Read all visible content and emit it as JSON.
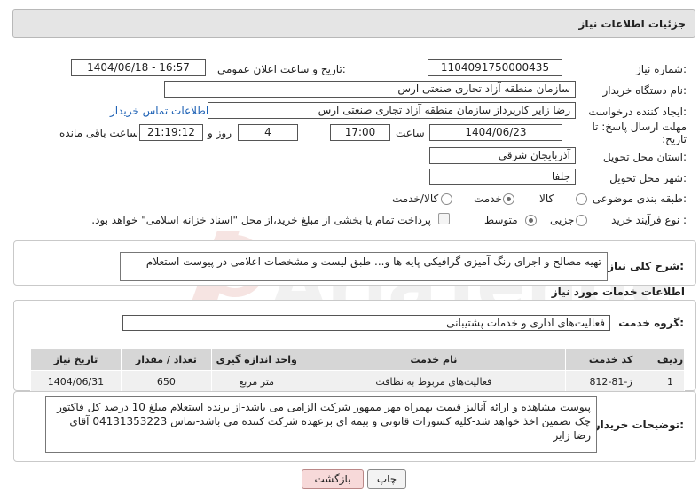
{
  "header": {
    "title": "جزئیات اطلاعات نیاز"
  },
  "fields": {
    "need_number_label": "شماره نیاز:",
    "need_number": "1104091750000435",
    "announce_label": "تاریخ و ساعت اعلان عمومی:",
    "announce_value": "1404/06/18 - 16:57",
    "buyer_org_label": "نام دستگاه خریدار:",
    "buyer_org": "سازمان منطقه آزاد تجاری صنعتی ارس",
    "creator_label": "ایجاد کننده درخواست:",
    "creator": "رضا زایر کارپرداز سازمان منطقه آزاد تجاری صنعتی ارس",
    "contact_link": "اطلاعات تماس خریدار",
    "deadline_label": "مهلت ارسال پاسخ: تا تاریخ:",
    "deadline_date": "1404/06/23",
    "time_label": "ساعت",
    "deadline_time": "17:00",
    "days_value": "4",
    "days_label": "روز و",
    "remaining_time": "21:19:12",
    "remaining_label": "ساعت باقی مانده",
    "province_label": "استان محل تحویل:",
    "province": "آذربایجان شرقی",
    "city_label": "شهر محل تحویل:",
    "city": "جلفا",
    "category_label": "طبقه بندی موضوعی:",
    "category_options": [
      "کالا",
      "خدمت",
      "کالا/خدمت"
    ],
    "purchase_type_label": "نوع فرآیند خرید :",
    "purchase_options": [
      "جزیی",
      "متوسط"
    ],
    "payment_note": "پرداخت تمام یا بخشی از مبلغ خرید،از محل \"اسناد خزانه اسلامی\" خواهد بود."
  },
  "summary": {
    "label": "شرح کلی نیاز:",
    "text": "تهیه مصالح و اجرای رنگ آمیزی گرافیکی پایه ها و... طبق لیست و مشخصات اعلامی در پیوست استعلام"
  },
  "services": {
    "section_title": "اطلاعات خدمات مورد نیاز",
    "group_label": "گروه خدمت:",
    "group_value": "فعالیت‌های اداری و خدمات پشتیبانی",
    "columns": [
      "ردیف",
      "کد خدمت",
      "نام خدمت",
      "واحد اندازه گیری",
      "تعداد / مقدار",
      "تاریخ نیاز"
    ],
    "rows": [
      [
        "1",
        "ز-81-812",
        "فعالیت‌های مربوط به نظافت",
        "متر مربع",
        "650",
        "1404/06/31"
      ]
    ]
  },
  "buyer_notes": {
    "label": "توضیحات خریدار:",
    "text": "پیوست مشاهده و ارائه آنالیز قیمت بهمراه مهر ممهور شرکت الزامی می باشد-از برنده استعلام مبلغ 10 درصد کل فاکتور چک تضمین اخذ خواهد شد-کلیه کسورات قانونی و بیمه ای برعهده شرکت کننده می باشد-تماس 04131353223 آقای رضا زایر"
  },
  "buttons": {
    "print": "چاپ",
    "back": "بازگشت"
  },
  "watermark_text": "AriaTender.net"
}
